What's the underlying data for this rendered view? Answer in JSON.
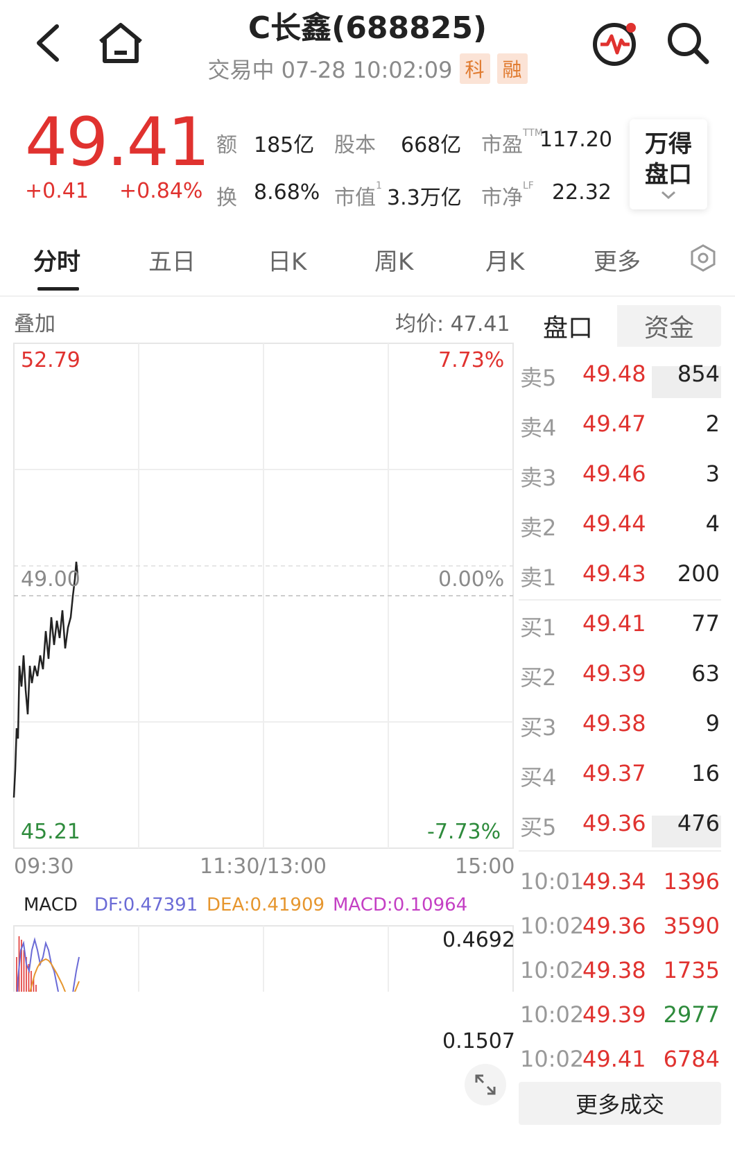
{
  "header": {
    "title": "C长鑫(688825)",
    "status": "交易中 07-28 10:02:09",
    "tags": [
      "科",
      "融"
    ]
  },
  "quote": {
    "price": "49.41",
    "change": "+0.41",
    "change_pct": "+0.84%",
    "stats": [
      {
        "key": "额",
        "value": "185亿"
      },
      {
        "key": "股本",
        "value": "668亿"
      },
      {
        "key": "市盈",
        "sup": "TTM",
        "value": "117.20"
      },
      {
        "key": "换",
        "value": "8.68%"
      },
      {
        "key": "市值",
        "sup": "1",
        "value": "3.3万亿"
      },
      {
        "key": "市净",
        "sup": "LF",
        "value": "22.32"
      }
    ],
    "wind_button": {
      "line1": "万得",
      "line2": "盘口"
    }
  },
  "tabs": [
    "分时",
    "五日",
    "日K",
    "周K",
    "月K",
    "更多"
  ],
  "intraday": {
    "overlay_label": "叠加",
    "avg_label": "均价: 47.41",
    "y_high": "52.79",
    "y_high_pct": "7.73%",
    "y_mid": "49.00",
    "y_mid_pct": "0.00%",
    "y_low": "45.21",
    "y_low_pct": "-7.73%",
    "time_start": "09:30",
    "time_mid": "11:30/13:00",
    "time_end": "15:00",
    "colors": {
      "up": "#e0322f",
      "down": "#2e8b3c",
      "line": "#222222"
    }
  },
  "macd": {
    "label": "MACD",
    "df": "DF:0.47391",
    "dea": "DEA:0.41909",
    "macd": "MACD:0.10964",
    "y_top": "0.4692",
    "y_mid": "0.1507",
    "colors": {
      "df": "#6b6bd6",
      "dea": "#e6962e",
      "macd": "#c43fc4"
    }
  },
  "orderbook": {
    "tabs": [
      "盘口",
      "资金"
    ],
    "asks": [
      {
        "label": "卖5",
        "price": "49.48",
        "vol": "854"
      },
      {
        "label": "卖4",
        "price": "49.47",
        "vol": "2"
      },
      {
        "label": "卖3",
        "price": "49.46",
        "vol": "3"
      },
      {
        "label": "卖2",
        "price": "49.44",
        "vol": "4"
      },
      {
        "label": "卖1",
        "price": "49.43",
        "vol": "200"
      }
    ],
    "bids": [
      {
        "label": "买1",
        "price": "49.41",
        "vol": "77"
      },
      {
        "label": "买2",
        "price": "49.39",
        "vol": "63"
      },
      {
        "label": "买3",
        "price": "49.38",
        "vol": "9"
      },
      {
        "label": "买4",
        "price": "49.37",
        "vol": "16"
      },
      {
        "label": "买5",
        "price": "49.36",
        "vol": "476"
      }
    ],
    "trades": [
      {
        "time": "10:01",
        "price": "49.34",
        "vol": "1396",
        "side": "up"
      },
      {
        "time": "10:02",
        "price": "49.36",
        "vol": "3590",
        "side": "up"
      },
      {
        "time": "10:02",
        "price": "49.38",
        "vol": "1735",
        "side": "up"
      },
      {
        "time": "10:02",
        "price": "49.39",
        "vol": "2977",
        "side": "down"
      },
      {
        "time": "10:02",
        "price": "49.41",
        "vol": "6784",
        "side": "up"
      }
    ],
    "more_trades": "更多成交"
  }
}
